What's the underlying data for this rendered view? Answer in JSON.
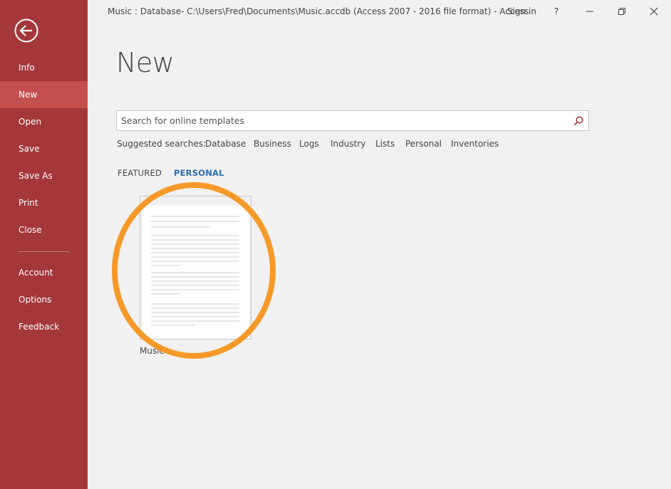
{
  "window": {
    "title": "Music : Database- C:\\Users\\Fred\\Documents\\Music.accdb (Access 2007 - 2016 file format) - Access",
    "sign_in": "Sign in",
    "help": "?"
  },
  "sidebar": {
    "items": [
      {
        "label": "Info"
      },
      {
        "label": "New",
        "active": true
      },
      {
        "label": "Open"
      },
      {
        "label": "Save"
      },
      {
        "label": "Save As"
      },
      {
        "label": "Print"
      },
      {
        "label": "Close"
      },
      {
        "label": "Account"
      },
      {
        "label": "Options"
      },
      {
        "label": "Feedback"
      }
    ]
  },
  "main": {
    "title": "New",
    "search": {
      "placeholder": "Search for online templates",
      "value": ""
    },
    "suggested": {
      "label": "Suggested searches:",
      "items": [
        "Database",
        "Business",
        "Logs",
        "Industry",
        "Lists",
        "Personal",
        "Inventories"
      ]
    },
    "tabs": [
      {
        "label": "FEATURED",
        "active": false
      },
      {
        "label": "PERSONAL",
        "active": true
      }
    ],
    "templates": [
      {
        "name": "Music"
      }
    ]
  },
  "colors": {
    "sidebar": "#a4373a",
    "sidebar_active": "#c3504f",
    "accent_link": "#2b6cb5",
    "highlight": "#f7941d"
  },
  "icons": [
    "back-arrow-icon",
    "minimize-icon",
    "restore-icon",
    "close-icon",
    "search-icon"
  ]
}
